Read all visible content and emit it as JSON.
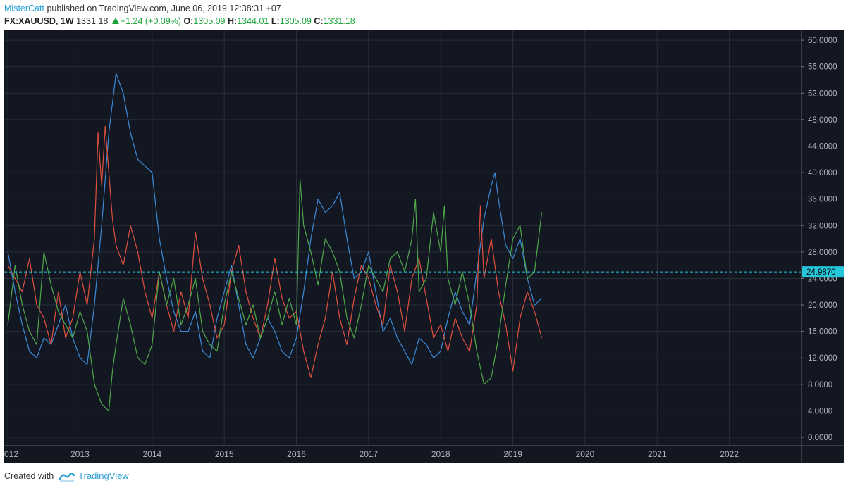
{
  "header": {
    "user": "MisterCatt",
    "published": "published on TradingView.com, June 06, 2019 12:38:31 +07",
    "symbol": "FX:XAUUSD, 1W",
    "price": "1331.18",
    "change": "+1.24 (+0.09%)",
    "o_label": "O:",
    "o_value": "1305.09",
    "h_label": "H:",
    "h_value": "1344.01",
    "l_label": "L:",
    "l_value": "1305.09",
    "c_label": "C:",
    "c_value": "1331.18"
  },
  "footer": {
    "created_with": "Created with",
    "brand": "TradingView"
  },
  "colors": {
    "background": "#131722",
    "grid": "#2a2e39",
    "blue": "#3b8bd9",
    "red": "#e0503f",
    "green": "#4fa84a",
    "level": "#26c6da"
  },
  "chart_data": {
    "type": "line",
    "x_ticks": [
      "012",
      "2013",
      "2014",
      "2015",
      "2016",
      "2017",
      "2018",
      "2019",
      "2020",
      "2021",
      "2022"
    ],
    "y_ticks": [
      "60.0000",
      "56.0000",
      "52.0000",
      "48.0000",
      "44.0000",
      "40.0000",
      "36.0000",
      "32.0000",
      "28.0000",
      "24.0000",
      "20.0000",
      "16.0000",
      "12.0000",
      "8.0000",
      "4.0000",
      "0.0000"
    ],
    "ylim": [
      0,
      61.5
    ],
    "xlim": [
      2011.95,
      2023.0
    ],
    "level_line": {
      "value": 24.987,
      "label": "24.9870"
    },
    "series": [
      {
        "color": "blue",
        "x": [
          2012.0,
          2012.1,
          2012.2,
          2012.3,
          2012.4,
          2012.5,
          2012.6,
          2012.7,
          2012.8,
          2012.9,
          2013.0,
          2013.1,
          2013.2,
          2013.3,
          2013.4,
          2013.5,
          2013.6,
          2013.7,
          2013.8,
          2013.9,
          2014.0,
          2014.1,
          2014.2,
          2014.3,
          2014.4,
          2014.5,
          2014.6,
          2014.7,
          2014.8,
          2014.9,
          2015.0,
          2015.1,
          2015.2,
          2015.3,
          2015.4,
          2015.5,
          2015.6,
          2015.7,
          2015.8,
          2015.9,
          2016.0,
          2016.1,
          2016.2,
          2016.3,
          2016.4,
          2016.5,
          2016.6,
          2016.7,
          2016.8,
          2016.9,
          2017.0,
          2017.1,
          2017.2,
          2017.3,
          2017.4,
          2017.5,
          2017.6,
          2017.7,
          2017.8,
          2017.9,
          2018.0,
          2018.1,
          2018.2,
          2018.3,
          2018.4,
          2018.5,
          2018.6,
          2018.7,
          2018.75,
          2018.8,
          2018.9,
          2019.0,
          2019.1,
          2019.2,
          2019.3,
          2019.4
        ],
        "y": [
          28,
          22,
          17,
          13,
          12,
          15,
          14,
          17,
          20,
          15,
          12,
          11,
          20,
          32,
          46,
          55,
          52,
          46,
          42,
          41,
          40,
          30,
          24,
          19,
          16,
          16,
          19,
          13,
          12,
          18,
          22,
          26,
          20,
          14,
          12,
          15,
          18,
          16,
          13,
          12,
          15,
          22,
          30,
          36,
          34,
          35,
          37,
          30,
          24,
          25,
          28,
          22,
          16,
          18,
          15,
          13,
          11,
          15,
          14,
          12,
          13,
          18,
          22,
          19,
          17,
          25,
          33,
          38,
          40,
          36,
          29,
          27,
          30,
          24,
          20,
          21
        ]
      },
      {
        "color": "red",
        "x": [
          2012.0,
          2012.1,
          2012.2,
          2012.3,
          2012.4,
          2012.5,
          2012.6,
          2012.7,
          2012.8,
          2012.9,
          2013.0,
          2013.1,
          2013.2,
          2013.25,
          2013.3,
          2013.35,
          2013.45,
          2013.5,
          2013.6,
          2013.7,
          2013.8,
          2013.9,
          2014.0,
          2014.1,
          2014.2,
          2014.3,
          2014.4,
          2014.5,
          2014.6,
          2014.7,
          2014.8,
          2014.9,
          2015.0,
          2015.1,
          2015.2,
          2015.3,
          2015.4,
          2015.5,
          2015.6,
          2015.7,
          2015.8,
          2015.9,
          2016.0,
          2016.1,
          2016.2,
          2016.3,
          2016.4,
          2016.5,
          2016.6,
          2016.7,
          2016.8,
          2016.9,
          2017.0,
          2017.1,
          2017.2,
          2017.3,
          2017.4,
          2017.5,
          2017.6,
          2017.7,
          2017.8,
          2017.9,
          2018.0,
          2018.1,
          2018.2,
          2018.3,
          2018.4,
          2018.5,
          2018.55,
          2018.6,
          2018.7,
          2018.8,
          2018.9,
          2019.0,
          2019.1,
          2019.2,
          2019.3,
          2019.4
        ],
        "y": [
          26,
          24,
          22,
          27,
          20,
          18,
          14,
          22,
          15,
          18,
          25,
          20,
          30,
          46,
          38,
          47,
          33,
          29,
          26,
          32,
          28,
          22,
          18,
          25,
          20,
          16,
          22,
          18,
          31,
          24,
          20,
          15,
          17,
          25,
          29,
          22,
          18,
          15,
          20,
          27,
          21,
          18,
          19,
          13,
          9,
          14,
          18,
          25,
          18,
          14,
          21,
          26,
          24,
          20,
          17,
          26,
          22,
          16,
          24,
          27,
          21,
          15,
          17,
          13,
          18,
          15,
          13,
          20,
          35,
          24,
          30,
          22,
          17,
          10,
          18,
          22,
          19,
          15
        ]
      },
      {
        "color": "green",
        "x": [
          2012.0,
          2012.1,
          2012.2,
          2012.3,
          2012.4,
          2012.5,
          2012.6,
          2012.7,
          2012.8,
          2012.9,
          2013.0,
          2013.1,
          2013.2,
          2013.3,
          2013.4,
          2013.45,
          2013.5,
          2013.6,
          2013.7,
          2013.8,
          2013.9,
          2014.0,
          2014.1,
          2014.2,
          2014.3,
          2014.4,
          2014.5,
          2014.6,
          2014.7,
          2014.8,
          2014.9,
          2015.0,
          2015.1,
          2015.2,
          2015.3,
          2015.4,
          2015.5,
          2015.6,
          2015.7,
          2015.8,
          2015.9,
          2016.0,
          2016.05,
          2016.1,
          2016.2,
          2016.3,
          2016.4,
          2016.5,
          2016.6,
          2016.7,
          2016.8,
          2016.9,
          2017.0,
          2017.1,
          2017.2,
          2017.3,
          2017.4,
          2017.5,
          2017.6,
          2017.65,
          2017.7,
          2017.8,
          2017.9,
          2018.0,
          2018.05,
          2018.1,
          2018.2,
          2018.3,
          2018.4,
          2018.5,
          2018.6,
          2018.7,
          2018.8,
          2018.9,
          2019.0,
          2019.1,
          2019.15,
          2019.2,
          2019.3,
          2019.4
        ],
        "y": [
          17,
          26,
          20,
          16,
          14,
          28,
          23,
          19,
          17,
          15,
          19,
          16,
          8,
          5,
          4,
          10,
          14,
          21,
          17,
          12,
          11,
          14,
          25,
          20,
          24,
          17,
          20,
          24,
          16,
          14,
          13,
          20,
          25,
          21,
          17,
          20,
          15,
          18,
          22,
          17,
          21,
          17,
          39,
          32,
          28,
          23,
          30,
          28,
          25,
          18,
          15,
          20,
          26,
          24,
          22,
          27,
          28,
          25,
          30,
          36,
          22,
          24,
          34,
          28,
          35,
          24,
          20,
          25,
          20,
          13,
          8,
          9,
          15,
          23,
          30,
          32,
          28,
          24,
          25,
          34
        ]
      }
    ]
  }
}
